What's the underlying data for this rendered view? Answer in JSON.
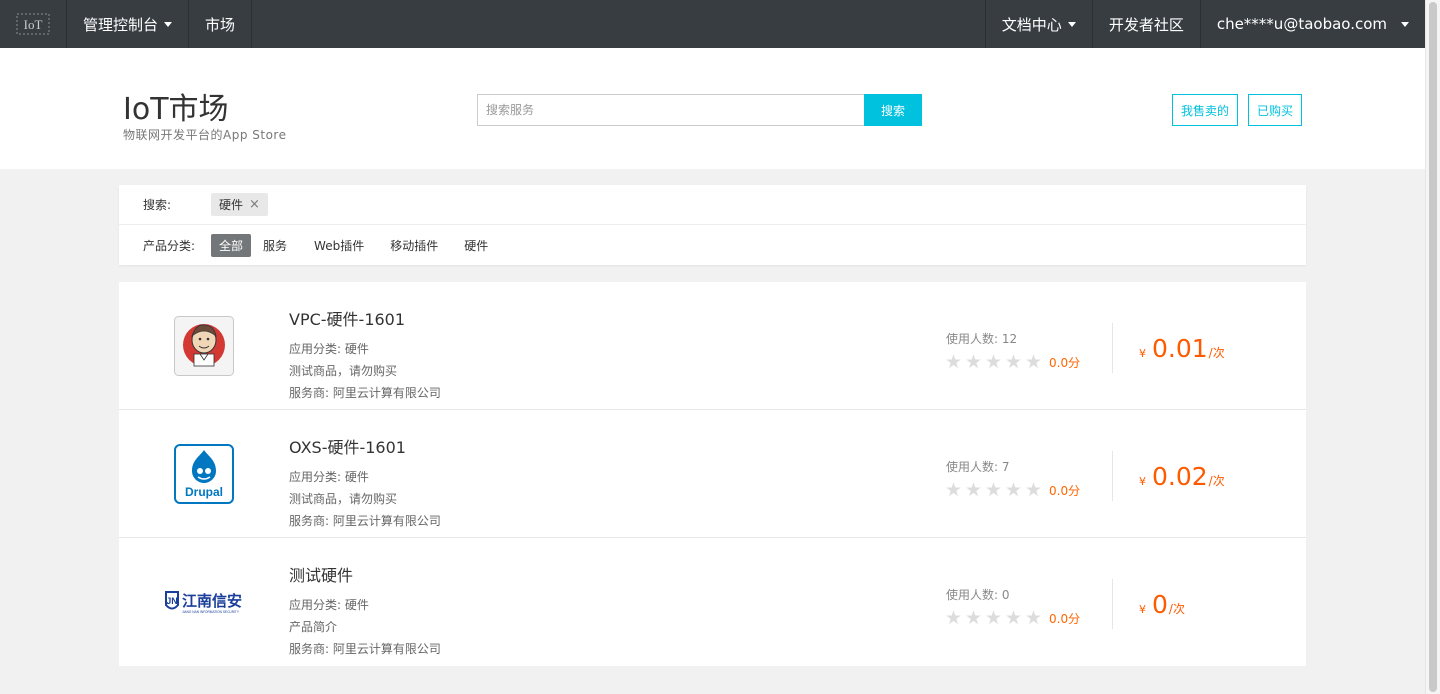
{
  "nav": {
    "console_label": "管理控制台",
    "market_label": "市场",
    "docs_label": "文档中心",
    "community_label": "开发者社区",
    "user_label": "che****u@taobao.com"
  },
  "header": {
    "title": "IoT市场",
    "subtitle": "物联网开发平台的App Store",
    "search_placeholder": "搜索服务",
    "search_value": "",
    "search_button": "搜索",
    "sold_button": "我售卖的",
    "bought_button": "已购买"
  },
  "filter": {
    "search_label": "搜索:",
    "search_chip": "硬件",
    "category_label": "产品分类:",
    "categories": [
      "全部",
      "服务",
      "Web插件",
      "移动插件",
      "硬件"
    ],
    "active_category": "全部"
  },
  "products": [
    {
      "name": "VPC-硬件-1601",
      "category": "应用分类: 硬件",
      "description": "测试商品，请勿购买",
      "vendor": "服务商: 阿里云计算有限公司",
      "users": "使用人数: 12",
      "rating": 0,
      "score": "0.0分",
      "currency": "¥",
      "price": "0.01",
      "unit": "/次",
      "logo": "jenkins-logo-icon"
    },
    {
      "name": "OXS-硬件-1601",
      "category": "应用分类: 硬件",
      "description": "测试商品，请勿购买",
      "vendor": "服务商: 阿里云计算有限公司",
      "users": "使用人数: 7",
      "rating": 0,
      "score": "0.0分",
      "currency": "¥",
      "price": "0.02",
      "unit": "/次",
      "logo": "drupal-logo-icon"
    },
    {
      "name": "测试硬件",
      "category": "应用分类: 硬件",
      "description": "产品简介",
      "vendor": "服务商: 阿里云计算有限公司",
      "users": "使用人数: 0",
      "rating": 0,
      "score": "0.0分",
      "currency": "¥",
      "price": "0",
      "unit": "/次",
      "logo": "jiangnan-xinan-logo-icon"
    }
  ],
  "logos": {
    "drupal_text": "Drupal",
    "jiangnan_text": "江南信安",
    "jiangnan_sub": "JIANG NAN INFORMATION SECURITY"
  },
  "colors": {
    "nav_bg": "#373d41",
    "accent": "#00c1de",
    "price": "#ff5a00",
    "score": "#ff6600",
    "active_category_bg": "#73777a"
  }
}
